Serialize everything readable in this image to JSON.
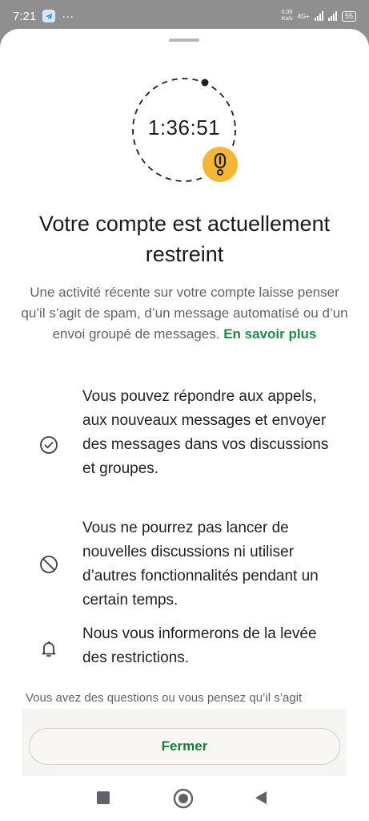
{
  "status_bar": {
    "time": "7:21",
    "more": "···",
    "net_speed": "0,00\nKo/s",
    "net_type": "4G+",
    "battery": "55"
  },
  "timer": {
    "value": "1:36:51"
  },
  "title": "Votre compte est actuellement restreint",
  "description": {
    "text": "Une activité récente sur votre compte laisse penser qu’il s’agit de spam, d’un message automatisé ou d’un envoi groupé de messages.",
    "link": "En savoir plus"
  },
  "info_items": [
    {
      "icon": "check-circle-icon",
      "text": "Vous pouvez répondre aux appels, aux nouveaux messages et envoyer des messages dans vos discussions et groupes."
    },
    {
      "icon": "block-icon",
      "text": "Vous ne pourrez pas lancer de nouvelles discussions ni utiliser d’autres fonctionnalités pendant un certain temps."
    },
    {
      "icon": "bell-icon",
      "text": "Nous vous informerons de la levée des restrictions."
    }
  ],
  "footer": {
    "text": "Vous avez des questions ou vous pensez qu’il s’agit"
  },
  "close_button": {
    "label": "Fermer"
  },
  "colors": {
    "accent_green": "#1a8b46",
    "warning": "#f5b731",
    "overlay": "#8f8f8f"
  }
}
